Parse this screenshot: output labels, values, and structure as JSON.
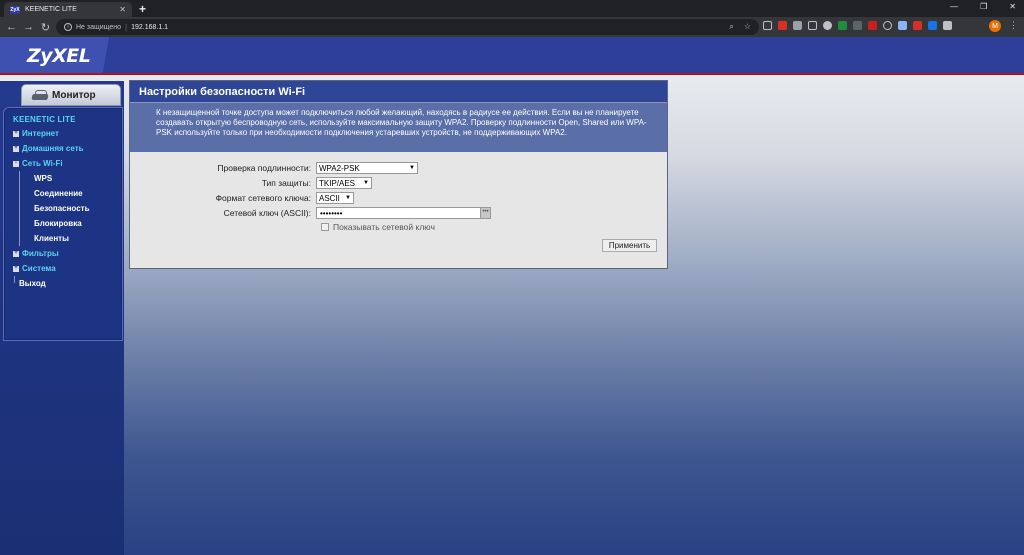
{
  "browser": {
    "tab_title": "KEENETIC LITE",
    "favicon_text": "ZyX",
    "new_tab": "+",
    "insecure_label": "Не защищено",
    "url": "192.168.1.1",
    "avatar_letter": "М"
  },
  "brand": {
    "logo": "ZyXEL",
    "accent": "#2d3f9a",
    "stripe": "#b0131c"
  },
  "sidebar": {
    "monitor_label": "Монитор",
    "device": "KEENETIC LITE",
    "items": [
      {
        "label": "Интернет",
        "expander": "+"
      },
      {
        "label": "Домашняя сеть",
        "expander": "+"
      },
      {
        "label": "Сеть Wi-Fi",
        "expander": "-"
      },
      {
        "label": "WPS"
      },
      {
        "label": "Соединение"
      },
      {
        "label": "Безопасность"
      },
      {
        "label": "Блокировка"
      },
      {
        "label": "Клиенты"
      },
      {
        "label": "Фильтры",
        "expander": "+"
      },
      {
        "label": "Система",
        "expander": "+"
      },
      {
        "label": "Выход"
      }
    ]
  },
  "panel": {
    "title": "Настройки безопасности Wi-Fi",
    "description": "К незащищенной точке доступа может подключиться любой желающий, находясь в радиусе ее действия. Если вы не планируете создавать открытую беспроводную сеть, используйте максимальную защиту WPA2. Проверку подлинности Open, Shared или WPA-PSK используйте только при необходимости подключения устаревших устройств, не поддерживающих WPA2.",
    "fields": {
      "auth": {
        "label": "Проверка подлинности:",
        "value": "WPA2-PSK"
      },
      "protection": {
        "label": "Тип защиты:",
        "value": "TKIP/AES"
      },
      "key_format": {
        "label": "Формат сетевого ключа:",
        "value": "ASCII"
      },
      "key": {
        "label": "Сетевой ключ (ASCII):",
        "value": "••••••••"
      }
    },
    "show_key_label": "Показывать сетевой ключ",
    "apply_label": "Применить"
  }
}
